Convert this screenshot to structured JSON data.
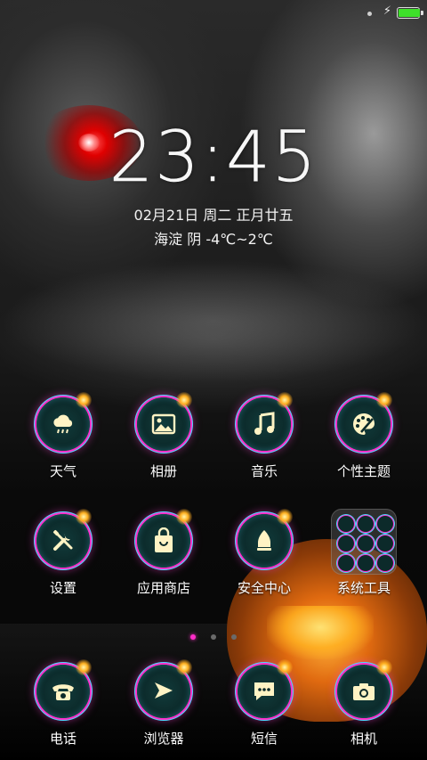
{
  "status_bar": {
    "battery_level": 1.0,
    "battery_color": "#3ee02a",
    "charging_icon": "lightning-icon"
  },
  "lock_widget": {
    "time": "23:45",
    "date": "02月21日 周二 正月廿五",
    "weather": "海淀 阴 -4℃~2℃"
  },
  "apps": [
    {
      "label": "天气",
      "icon": "cloud-rain-icon"
    },
    {
      "label": "相册",
      "icon": "picture-icon"
    },
    {
      "label": "音乐",
      "icon": "music-note-icon"
    },
    {
      "label": "个性主题",
      "icon": "palette-icon"
    },
    {
      "label": "设置",
      "icon": "tools-icon"
    },
    {
      "label": "应用商店",
      "icon": "shopping-bag-icon"
    },
    {
      "label": "安全中心",
      "icon": "shield-icon"
    },
    {
      "label": "系统工具",
      "icon": "folder-icon"
    }
  ],
  "page_indicator": {
    "count": 3,
    "active": 0
  },
  "dock": [
    {
      "label": "电话",
      "icon": "phone-icon"
    },
    {
      "label": "浏览器",
      "icon": "paper-plane-icon"
    },
    {
      "label": "短信",
      "icon": "message-icon"
    },
    {
      "label": "相机",
      "icon": "camera-icon"
    }
  ],
  "colors": {
    "ring_pink": "#ff2dc8",
    "ring_cyan": "#4fd8ff",
    "icon_cream": "#fff3c4"
  }
}
